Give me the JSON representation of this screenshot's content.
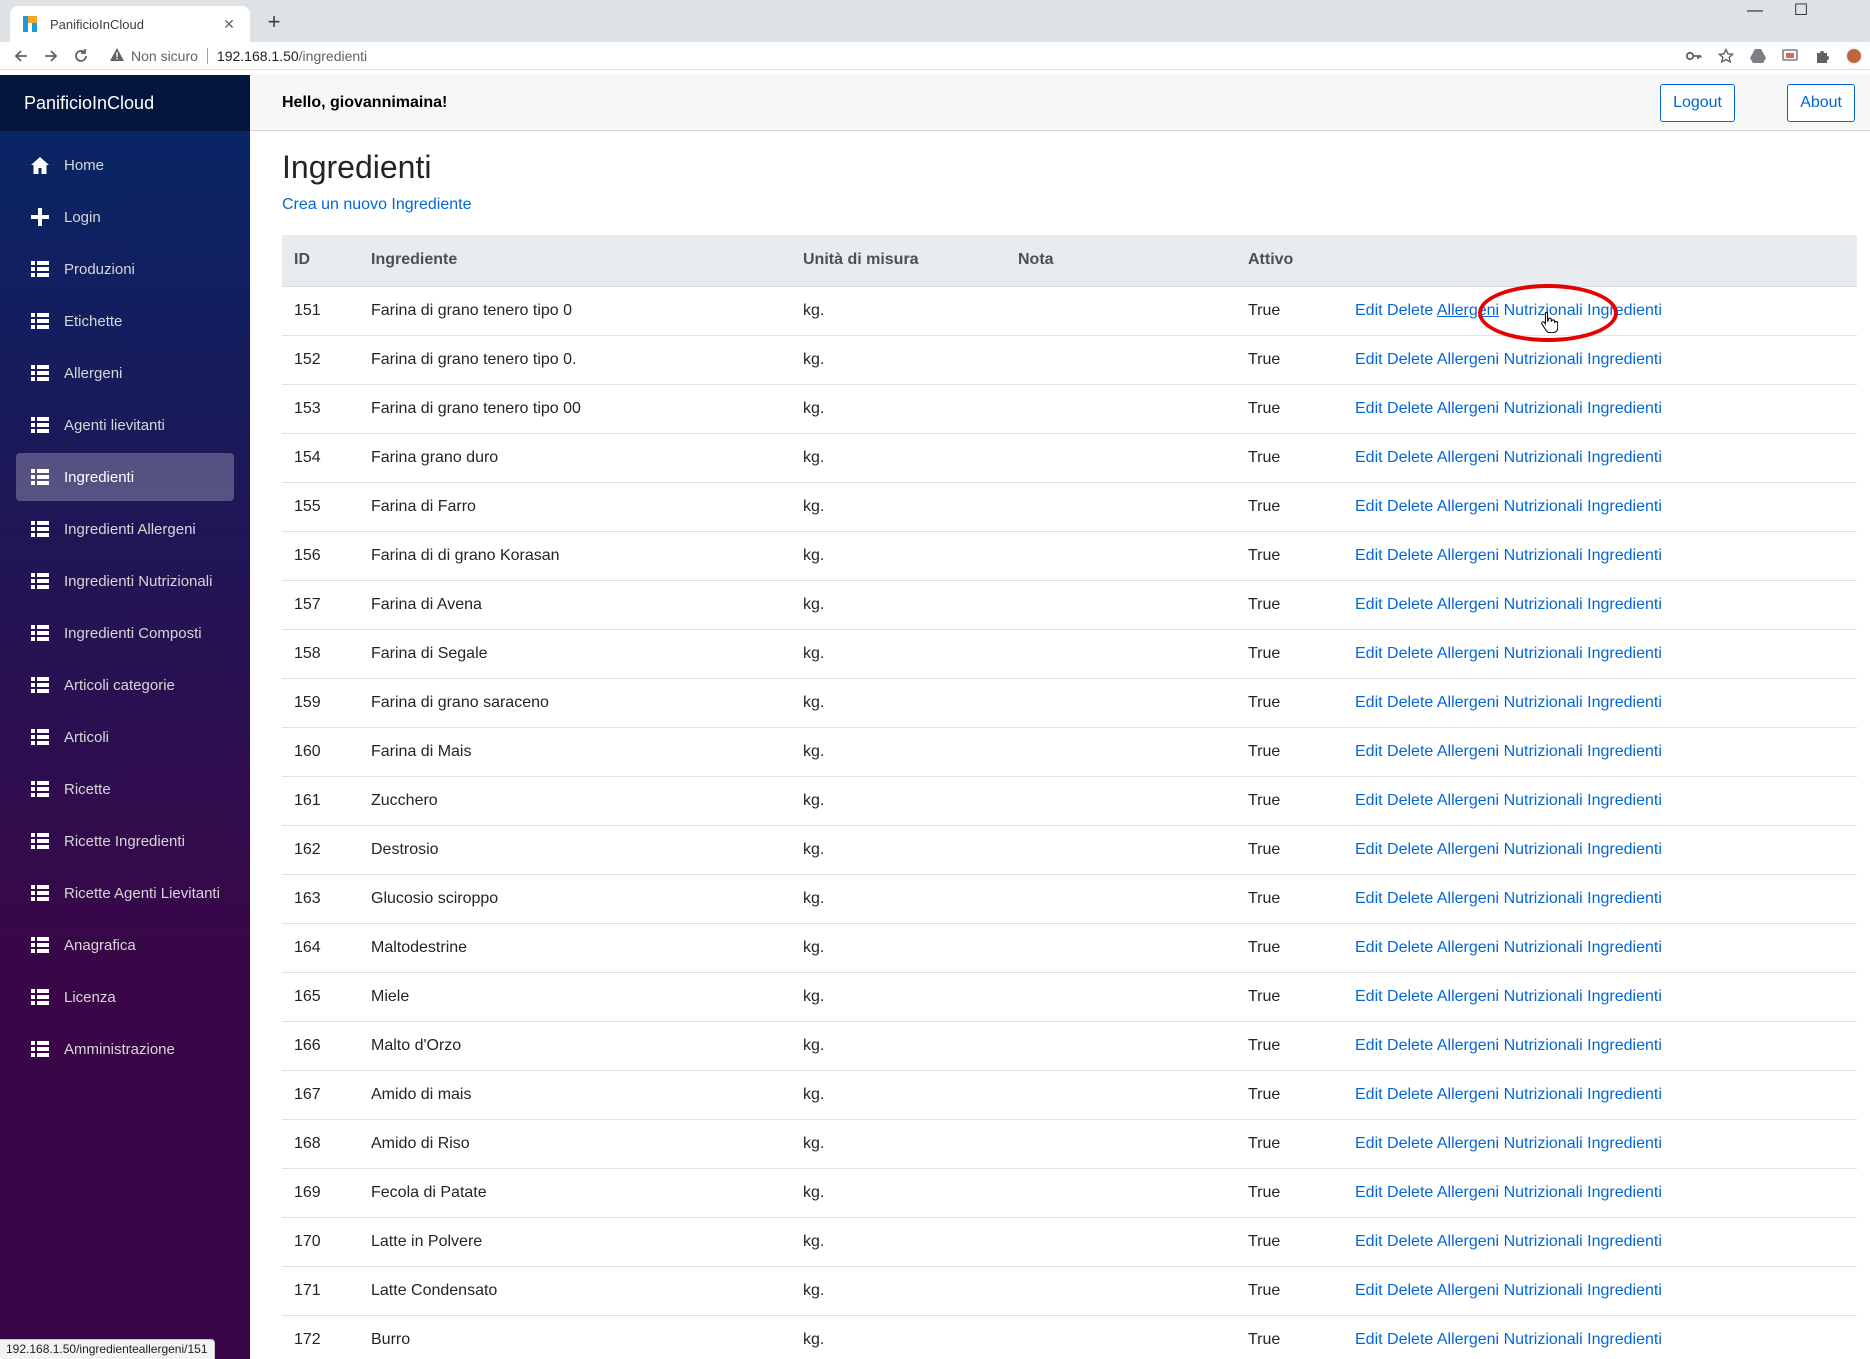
{
  "browser": {
    "tab_title": "PanificioInCloud",
    "tab_close": "✕",
    "new_tab": "+",
    "window_controls": {
      "minimize": "—",
      "maximize": "☐"
    },
    "security_label": "Non sicuro",
    "url_host": "192.168.1.50",
    "url_path": "/ingredienti",
    "status_url": "192.168.1.50/ingredienteallergeni/151"
  },
  "sidebar": {
    "brand": "PanificioInCloud",
    "items": [
      {
        "label": "Home",
        "icon": "home-icon",
        "active": false
      },
      {
        "label": "Login",
        "icon": "plus-icon",
        "active": false
      },
      {
        "label": "Produzioni",
        "icon": "list-icon",
        "active": false
      },
      {
        "label": "Etichette",
        "icon": "list-icon",
        "active": false
      },
      {
        "label": "Allergeni",
        "icon": "list-icon",
        "active": false
      },
      {
        "label": "Agenti lievitanti",
        "icon": "list-icon",
        "active": false
      },
      {
        "label": "Ingredienti",
        "icon": "list-icon",
        "active": true
      },
      {
        "label": "Ingredienti Allergeni",
        "icon": "list-icon",
        "active": false
      },
      {
        "label": "Ingredienti Nutrizionali",
        "icon": "list-icon",
        "active": false
      },
      {
        "label": "Ingredienti Composti",
        "icon": "list-icon",
        "active": false
      },
      {
        "label": "Articoli categorie",
        "icon": "list-icon",
        "active": false
      },
      {
        "label": "Articoli",
        "icon": "list-icon",
        "active": false
      },
      {
        "label": "Ricette",
        "icon": "list-icon",
        "active": false
      },
      {
        "label": "Ricette Ingredienti",
        "icon": "list-icon",
        "active": false
      },
      {
        "label": "Ricette Agenti Lievitanti",
        "icon": "list-icon",
        "active": false
      },
      {
        "label": "Anagrafica",
        "icon": "list-icon",
        "active": false
      },
      {
        "label": "Licenza",
        "icon": "list-icon",
        "active": false
      },
      {
        "label": "Amministrazione",
        "icon": "list-icon",
        "active": false
      }
    ]
  },
  "header": {
    "greeting": "Hello, giovannimaina!",
    "logout": "Logout",
    "about": "About"
  },
  "page": {
    "title": "Ingredienti",
    "create_link": "Crea un nuovo Ingrediente",
    "columns": [
      "ID",
      "Ingrediente",
      "Unità di misura",
      "Nota",
      "Attivo",
      ""
    ],
    "action_labels": {
      "edit": "Edit",
      "delete": "Delete",
      "allergeni": "Allergeni",
      "nutrizionali": "Nutrizionali",
      "ingredienti": "Ingredienti"
    },
    "rows": [
      {
        "id": "151",
        "name": "Farina di grano tenero tipo 0",
        "unit": "kg.",
        "note": "",
        "active": "True"
      },
      {
        "id": "152",
        "name": "Farina di grano tenero tipo 0.",
        "unit": "kg.",
        "note": "",
        "active": "True"
      },
      {
        "id": "153",
        "name": "Farina di grano tenero tipo 00",
        "unit": "kg.",
        "note": "",
        "active": "True"
      },
      {
        "id": "154",
        "name": "Farina grano duro",
        "unit": "kg.",
        "note": "",
        "active": "True"
      },
      {
        "id": "155",
        "name": "Farina di Farro",
        "unit": "kg.",
        "note": "",
        "active": "True"
      },
      {
        "id": "156",
        "name": "Farina di di grano Korasan",
        "unit": "kg.",
        "note": "",
        "active": "True"
      },
      {
        "id": "157",
        "name": "Farina di Avena",
        "unit": "kg.",
        "note": "",
        "active": "True"
      },
      {
        "id": "158",
        "name": "Farina di Segale",
        "unit": "kg.",
        "note": "",
        "active": "True"
      },
      {
        "id": "159",
        "name": "Farina di grano saraceno",
        "unit": "kg.",
        "note": "",
        "active": "True"
      },
      {
        "id": "160",
        "name": "Farina di Mais",
        "unit": "kg.",
        "note": "",
        "active": "True"
      },
      {
        "id": "161",
        "name": "Zucchero",
        "unit": "kg.",
        "note": "",
        "active": "True"
      },
      {
        "id": "162",
        "name": "Destrosio",
        "unit": "kg.",
        "note": "",
        "active": "True"
      },
      {
        "id": "163",
        "name": "Glucosio sciroppo",
        "unit": "kg.",
        "note": "",
        "active": "True"
      },
      {
        "id": "164",
        "name": "Maltodestrine",
        "unit": "kg.",
        "note": "",
        "active": "True"
      },
      {
        "id": "165",
        "name": "Miele",
        "unit": "kg.",
        "note": "",
        "active": "True"
      },
      {
        "id": "166",
        "name": "Malto d'Orzo",
        "unit": "kg.",
        "note": "",
        "active": "True"
      },
      {
        "id": "167",
        "name": "Amido di mais",
        "unit": "kg.",
        "note": "",
        "active": "True"
      },
      {
        "id": "168",
        "name": "Amido di Riso",
        "unit": "kg.",
        "note": "",
        "active": "True"
      },
      {
        "id": "169",
        "name": "Fecola di Patate",
        "unit": "kg.",
        "note": "",
        "active": "True"
      },
      {
        "id": "170",
        "name": "Latte in Polvere",
        "unit": "kg.",
        "note": "",
        "active": "True"
      },
      {
        "id": "171",
        "name": "Latte Condensato",
        "unit": "kg.",
        "note": "",
        "active": "True"
      },
      {
        "id": "172",
        "name": "Burro",
        "unit": "kg.",
        "note": "",
        "active": "True"
      }
    ]
  },
  "colors": {
    "link": "#0366d6",
    "sidebar_top": "#052767",
    "sidebar_bottom": "#3a0647",
    "highlight": "#e60000"
  }
}
